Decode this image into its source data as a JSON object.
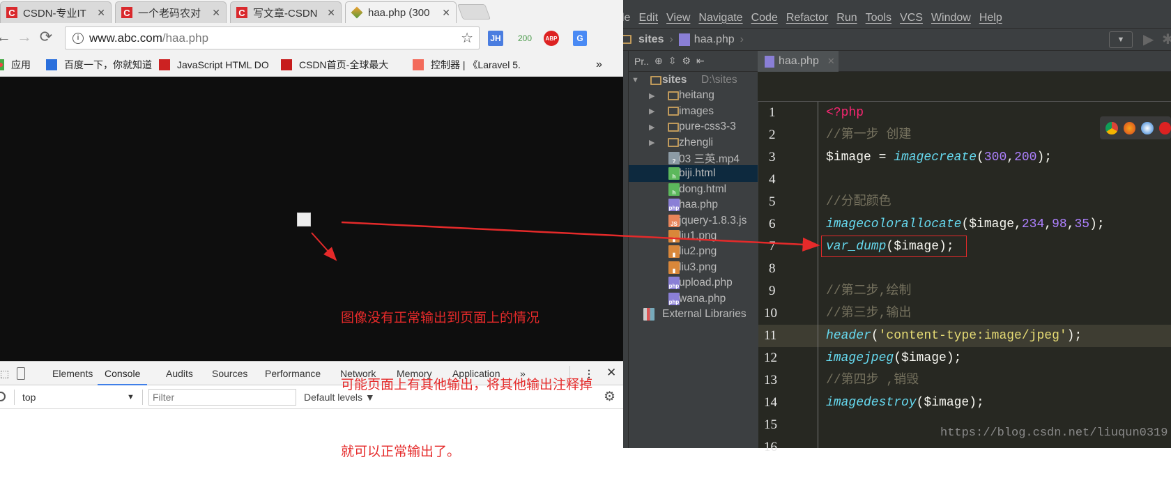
{
  "browser": {
    "tabs": [
      {
        "title": "CSDN-专业IT",
        "icon": "csdn-icon"
      },
      {
        "title": "一个老码农对",
        "icon": "csdn-icon"
      },
      {
        "title": "写文章-CSDN",
        "icon": "csdn-icon"
      },
      {
        "title": "haa.php (300",
        "icon": "php-page-icon",
        "active": true
      }
    ],
    "url_host": "www.abc.com",
    "url_path": "/haa.php",
    "extensions": [
      "JH",
      "200",
      "ABP",
      "G"
    ],
    "bookmarks": [
      {
        "label": "应用",
        "icon": "apps-icon"
      },
      {
        "label": "百度一下，你就知道",
        "icon": "baidu-icon"
      },
      {
        "label": "JavaScript HTML DO",
        "icon": "w3school-icon"
      },
      {
        "label": "CSDN首页-全球最大",
        "icon": "csdn-icon"
      },
      {
        "label": "控制器 | 《Laravel 5.",
        "icon": "laravel-icon"
      }
    ],
    "bookmarks_more": "»",
    "devtools": {
      "tabs": [
        "Elements",
        "Console",
        "Audits",
        "Sources",
        "Performance",
        "Network",
        "Memory",
        "Application"
      ],
      "active_tab": "Console",
      "more": "»",
      "context": "top",
      "filter_placeholder": "Filter",
      "levels": "Default levels ▼"
    }
  },
  "annotation": {
    "lines": [
      "图像没有正常输出到页面上的情况",
      "可能页面上有其他输出，将其他输出注释掉",
      "就可以正常输出了。"
    ],
    "color": "#e52a2a"
  },
  "ide": {
    "menu": [
      "le",
      "Edit",
      "View",
      "Navigate",
      "Code",
      "Refactor",
      "Run",
      "Tools",
      "VCS",
      "Window",
      "Help"
    ],
    "breadcrumb": [
      "sites",
      "haa.php"
    ],
    "project_label": "Pr..",
    "editor_tab": "haa.php",
    "tree": {
      "root": "sites",
      "root_path": "D:\\sites",
      "folders": [
        "heitang",
        "images",
        "pure-css3-3",
        "zhengli"
      ],
      "files": [
        {
          "name": "03 三英.mp4",
          "type": "unknown"
        },
        {
          "name": "biji.html",
          "type": "html",
          "selected": true
        },
        {
          "name": "dong.html",
          "type": "html"
        },
        {
          "name": "haa.php",
          "type": "php"
        },
        {
          "name": "jquery-1.8.3.js",
          "type": "js"
        },
        {
          "name": "liu1.png",
          "type": "image"
        },
        {
          "name": "liu2.png",
          "type": "image"
        },
        {
          "name": "liu3.png",
          "type": "image"
        },
        {
          "name": "upload.php",
          "type": "php"
        },
        {
          "name": "wana.php",
          "type": "php"
        }
      ],
      "external": "External Libraries"
    },
    "code": [
      [
        [
          "k",
          "<?php"
        ]
      ],
      [
        [
          "c",
          "//第一步 创建"
        ]
      ],
      [
        [
          "",
          "$image = "
        ],
        [
          "f",
          "imagecreate"
        ],
        [
          "",
          "("
        ],
        [
          "n",
          "300"
        ],
        [
          "",
          ","
        ],
        [
          "n",
          "200"
        ],
        [
          "",
          ");"
        ]
      ],
      [],
      [
        [
          "c",
          "//分配颜色"
        ]
      ],
      [
        [
          "f",
          "imagecolorallocate"
        ],
        [
          "",
          "($image,"
        ],
        [
          "n",
          "234"
        ],
        [
          "",
          ","
        ],
        [
          "n",
          "98"
        ],
        [
          "",
          ","
        ],
        [
          "n",
          "35"
        ],
        [
          "",
          ");"
        ]
      ],
      [
        [
          "f",
          "var_dump"
        ],
        [
          "",
          "($image);"
        ]
      ],
      [],
      [
        [
          "c",
          "//第二步,绘制"
        ]
      ],
      [
        [
          "c",
          "//第三步,输出"
        ]
      ],
      [
        [
          "f",
          "header"
        ],
        [
          "",
          "("
        ],
        [
          "s",
          "'content-type:image/jpeg'"
        ],
        [
          "",
          ");"
        ]
      ],
      [
        [
          "f",
          "imagejpeg"
        ],
        [
          "",
          "($image);"
        ]
      ],
      [
        [
          "c",
          "//第四步 ,销毁"
        ]
      ],
      [
        [
          "f",
          "imagedestroy"
        ],
        [
          "",
          "($image);"
        ]
      ],
      [],
      []
    ],
    "current_line": 11
  },
  "watermark": "https://blog.csdn.net/liuqun0319"
}
